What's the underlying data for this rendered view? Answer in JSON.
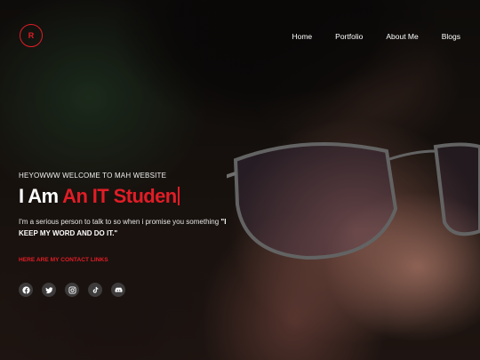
{
  "brand": {
    "logo_letter": "R"
  },
  "nav": {
    "items": [
      {
        "label": "Home"
      },
      {
        "label": "Portfolio"
      },
      {
        "label": "About Me"
      },
      {
        "label": "Blogs"
      }
    ]
  },
  "hero": {
    "welcome": "HEYOWWW WELCOME TO MAH WEBSITE",
    "headline_prefix": "I Am ",
    "headline_typed": "An IT Studen",
    "bio_text": "I'm a serious person to talk to so when i promise you something ",
    "bio_quote": "\"I KEEP MY WORD AND DO IT.\"",
    "contact_link": "HERE ARE MY CONTACT LINKS"
  },
  "socials": [
    {
      "icon": "facebook-icon"
    },
    {
      "icon": "twitter-icon"
    },
    {
      "icon": "instagram-icon"
    },
    {
      "icon": "tiktok-icon"
    },
    {
      "icon": "discord-icon"
    }
  ],
  "colors": {
    "accent": "#e11d26",
    "text": "#ffffff",
    "social_bg": "#464646"
  }
}
